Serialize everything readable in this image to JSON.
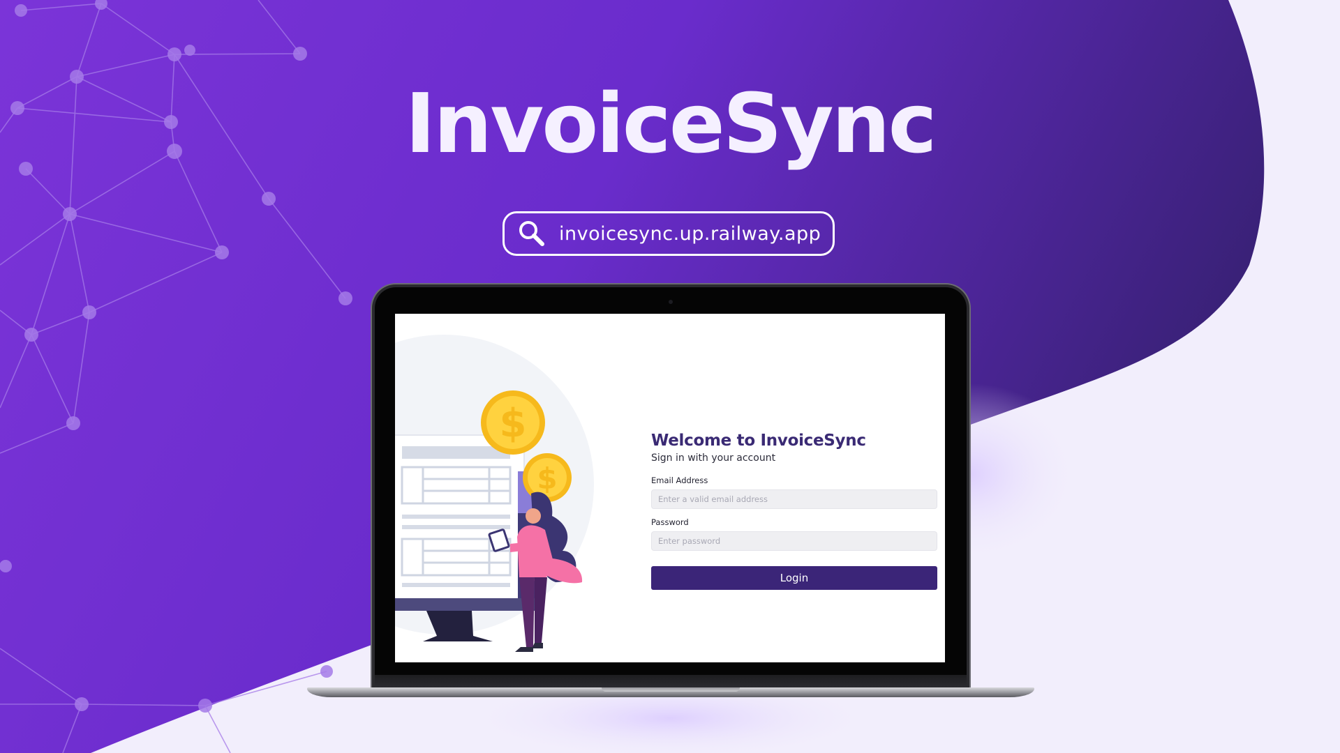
{
  "hero": {
    "title": "InvoiceSync",
    "url": "invoicesync.up.railway.app",
    "url_icon": "search-icon"
  },
  "login": {
    "title": "Welcome to InvoiceSync",
    "subtitle": "Sign in with your account",
    "email_label": "Email Address",
    "email_placeholder": "Enter a valid email address",
    "email_value": "",
    "password_label": "Password",
    "password_placeholder": "Enter password",
    "password_value": "",
    "login_button": "Login"
  },
  "illustration": {
    "icons": [
      "coin-dollar-icon",
      "monitor-invoice-icon",
      "woman-with-tablet-icon"
    ],
    "coin_symbol": "$"
  },
  "colors": {
    "background_purple": "#7a35d6",
    "deep_purple": "#3e2680",
    "page_lavender": "#f2eefc",
    "title_text": "#f5f0ff",
    "login_title": "#3a2a74",
    "login_button": "#3b2578",
    "coin_gold": "#f6b91c"
  }
}
